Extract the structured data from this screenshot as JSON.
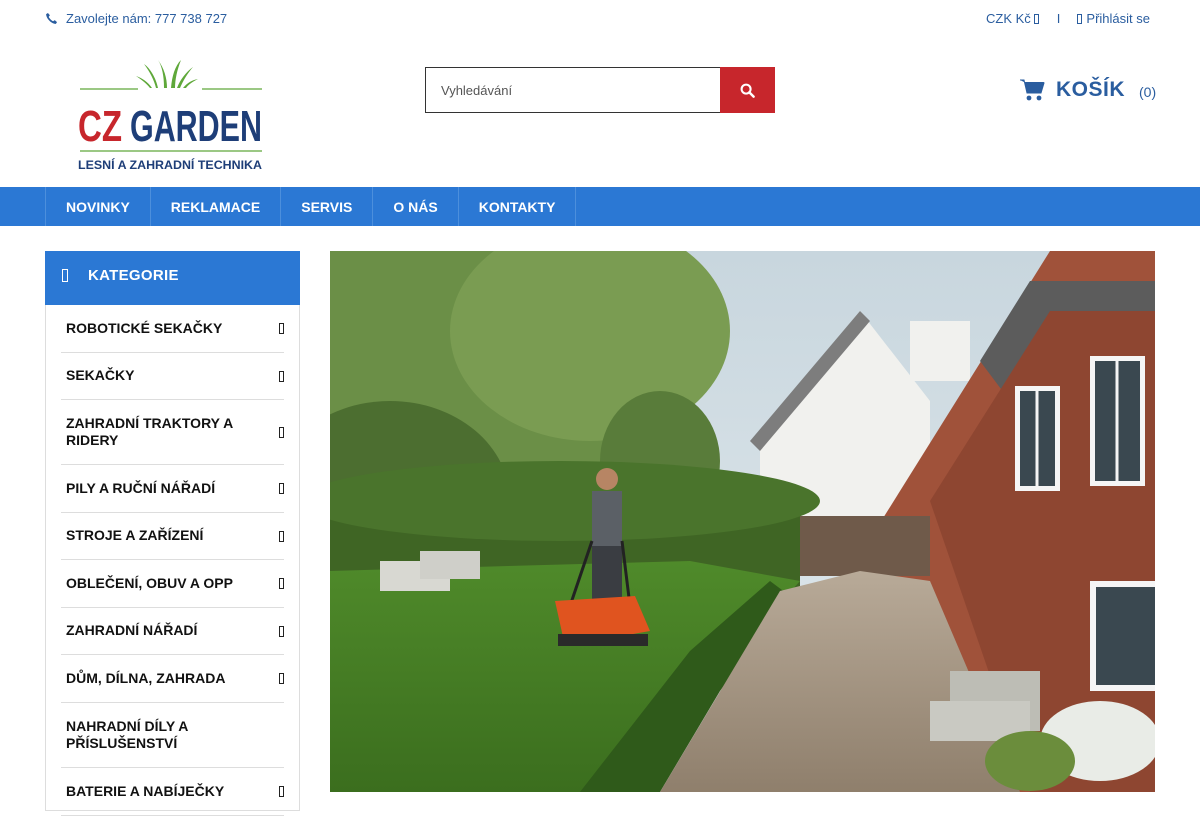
{
  "topbar": {
    "phone_text": "Zavolejte nám: 777 738 727",
    "currency": "CZK Kč",
    "separator": "I",
    "login": "Přihlásit se"
  },
  "logo": {
    "brand": "CZ GARDEN",
    "tagline": "LESNÍ A ZAHRADNÍ TECHNIKA"
  },
  "search": {
    "placeholder": "Vyhledávání"
  },
  "cart": {
    "label": "KOŠÍK",
    "count": "(0)"
  },
  "nav": {
    "items": [
      "NOVINKY",
      "REKLAMACE",
      "SERVIS",
      "O NÁS",
      "KONTAKTY"
    ]
  },
  "sidebar": {
    "title": "KATEGORIE",
    "items": [
      {
        "label": "ROBOTICKÉ SEKAČKY",
        "has_children": true
      },
      {
        "label": "SEKAČKY",
        "has_children": true
      },
      {
        "label": "ZAHRADNÍ TRAKTORY A RIDERY",
        "has_children": true
      },
      {
        "label": "PILY A RUČNÍ NÁŘADÍ",
        "has_children": true
      },
      {
        "label": "STROJE A ZAŘÍZENÍ",
        "has_children": true
      },
      {
        "label": "OBLEČENÍ, OBUV A OPP",
        "has_children": true
      },
      {
        "label": "ZAHRADNÍ NÁŘADÍ",
        "has_children": true
      },
      {
        "label": "DŮM, DÍLNA, ZAHRADA",
        "has_children": true
      },
      {
        "label": "NAHRADNÍ DÍLY A PŘÍSLUŠENSTVÍ",
        "has_children": false
      },
      {
        "label": "BATERIE A NABÍJEČKY",
        "has_children": true
      }
    ]
  },
  "colors": {
    "brand_blue": "#2b78d4",
    "link_blue": "#2a5d9f",
    "search_red": "#c7262c",
    "logo_red": "#c7262c",
    "logo_navy": "#1e3e78",
    "logo_green": "#5fa83a"
  },
  "icons": {
    "phone": "phone-icon",
    "search": "search-icon",
    "cart": "cart-icon",
    "menu": "menu-icon",
    "chevron": "chevron-right-icon",
    "user": "user-icon",
    "currency_caret": "caret-down-icon"
  }
}
